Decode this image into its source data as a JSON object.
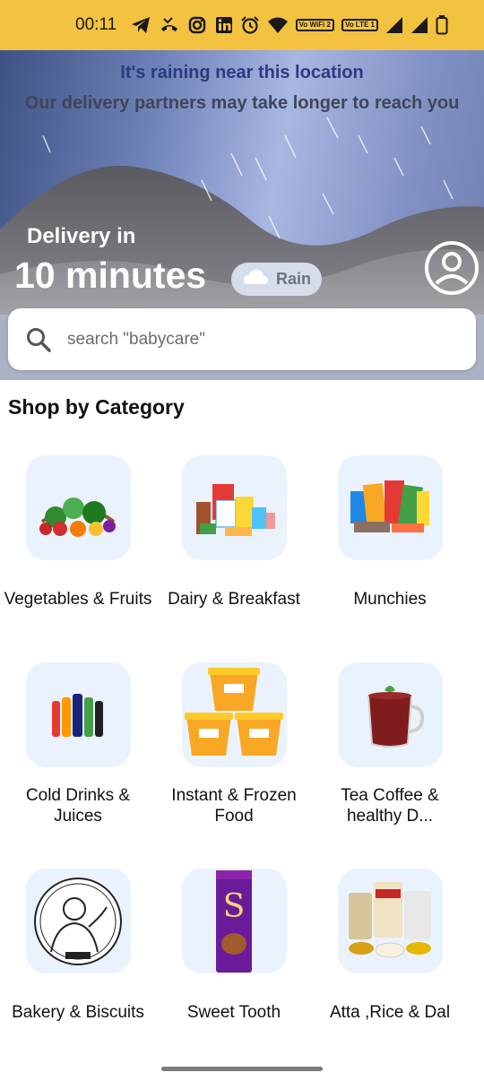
{
  "status_bar": {
    "time": "00:11",
    "icons": [
      "telegram-icon",
      "missed-call-icon",
      "instagram-icon",
      "linkedin-icon",
      "alarm-icon",
      "wifi-icon",
      "vowifi2-icon",
      "volte1-icon",
      "signal-icon",
      "signal-icon",
      "battery-icon"
    ],
    "badge_wifi": "Vo WiFi 2",
    "badge_lte": "Vo LTE 1"
  },
  "header": {
    "alert_title": "It's raining near this location",
    "alert_subtitle": "Our delivery partners may take longer to reach you",
    "delivery_label": "Delivery in",
    "delivery_time": "10 minutes",
    "weather_label": "Rain"
  },
  "search": {
    "placeholder": "search \"babycare\""
  },
  "section": {
    "title": "Shop by Category"
  },
  "categories": [
    {
      "label": "Vegetables & Fruits"
    },
    {
      "label": "Dairy & Breakfast"
    },
    {
      "label": "Munchies"
    },
    {
      "label": "Cold Drinks & Juices"
    },
    {
      "label": "Instant & Frozen Food"
    },
    {
      "label": "Tea Coffee & healthy D..."
    },
    {
      "label": "Bakery & Biscuits"
    },
    {
      "label": "Sweet Tooth"
    },
    {
      "label": "Atta ,Rice & Dal"
    }
  ],
  "colors": {
    "status_bar": "#f3c240",
    "tile_bg": "#eaf3fd",
    "alert_title": "#2d3b7f"
  }
}
